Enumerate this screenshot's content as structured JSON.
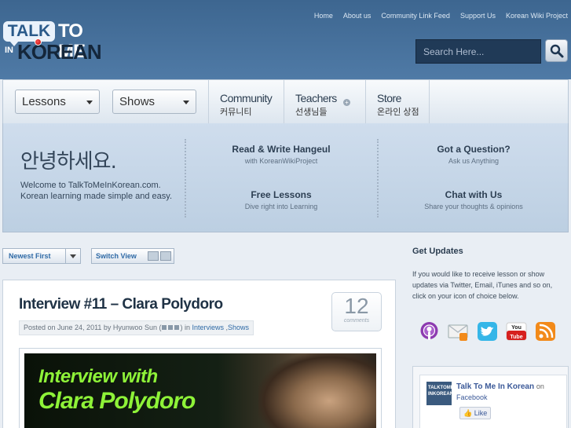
{
  "logo": {
    "talk": "TALK",
    "tome": "TO ME",
    "in": "IN",
    "korean": "KOREAN"
  },
  "topnav": [
    "Home",
    "About us",
    "Community Link Feed",
    "Support Us",
    "Korean Wiki Project"
  ],
  "search": {
    "placeholder": "Search Here..."
  },
  "mainnav": {
    "dropdowns": [
      "Lessons",
      "Shows"
    ],
    "items": [
      {
        "en": "Community",
        "ko": "커뮤니티"
      },
      {
        "en": "Teachers",
        "ko": "선생님들"
      },
      {
        "en": "Store",
        "ko": "온라인 상점"
      }
    ]
  },
  "panel": {
    "greeting": "안녕하세요.",
    "welcome_line1": "Welcome to TalkToMeInKorean.com.",
    "welcome_line2": "Korean learning made simple and easy.",
    "features": [
      {
        "title": "Read & Write Hangeul",
        "sub": "with KoreanWikiProject"
      },
      {
        "title": "Got a Question?",
        "sub": "Ask us Anything"
      },
      {
        "title": "Free Lessons",
        "sub": "Dive right into Learning"
      },
      {
        "title": "Chat with Us",
        "sub": "Share your thoughts & opinions"
      }
    ]
  },
  "controls": {
    "sort": "Newest First",
    "switch": "Switch View"
  },
  "post": {
    "title": "Interview #11 – Clara Polydoro",
    "comment_count": "12",
    "comment_label": "comments",
    "meta_prefix": "Posted on June 24, 2011 by Hyunwoo Sun (",
    "meta_mid": ") in ",
    "cat1": "Interviews",
    "cat_sep": " ,",
    "cat2": "Shows",
    "image_line1": "Interview with",
    "image_line2": "Clara Polydoro"
  },
  "sidebar": {
    "title": "Get Updates",
    "text": "If you would like to receive lesson or show updates via Twitter, Email, iTunes and so on, click on your icon of choice below.",
    "icons": [
      "podcast-icon",
      "email-rss-icon",
      "twitter-icon",
      "youtube-icon",
      "rss-icon"
    ],
    "facebook": {
      "name": "Talk To Me In Korean",
      "on": "on",
      "sub": "Facebook",
      "like": "Like",
      "thumb": "TALKTOME INKOREAN"
    }
  }
}
